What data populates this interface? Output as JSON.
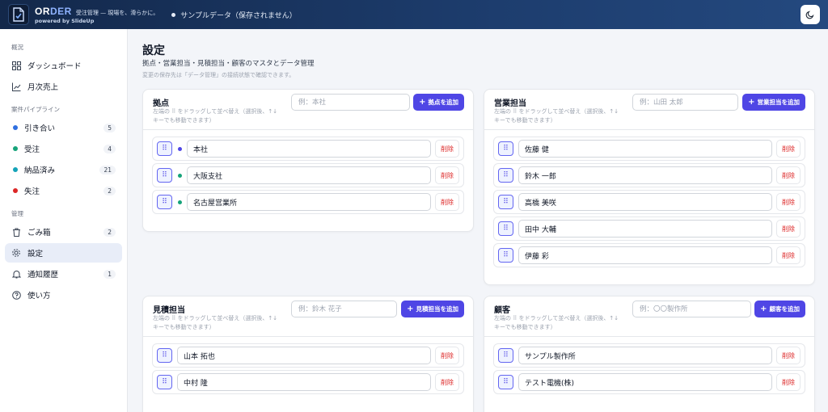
{
  "header": {
    "brand_or": "OR",
    "brand_der": "DER",
    "tagline": "受注管理 — 現場を、滑らかに。",
    "powered": "powered by SlideUp",
    "sample_status": "サンプルデータ（保存されません）",
    "theme_icon": "moon-icon"
  },
  "sidebar": {
    "sections": {
      "overview": "概況",
      "pipeline": "案件パイプライン",
      "manage": "管理"
    },
    "overview": [
      {
        "label": "ダッシュボード",
        "icon": "dashboard-icon"
      },
      {
        "label": "月次売上",
        "icon": "chart-line-icon"
      }
    ],
    "pipeline": [
      {
        "label": "引き合い",
        "count": "5",
        "color": "#2f6fe0"
      },
      {
        "label": "受注",
        "count": "4",
        "color": "#16a37a"
      },
      {
        "label": "納品済み",
        "count": "21",
        "color": "#14a3b8"
      },
      {
        "label": "失注",
        "count": "2",
        "color": "#dc2626"
      }
    ],
    "manage": [
      {
        "label": "ごみ箱",
        "count": "2",
        "icon": "trash-icon"
      },
      {
        "label": "設定",
        "icon": "gear-icon",
        "active": true
      },
      {
        "label": "通知履歴",
        "count": "1",
        "icon": "bell-icon"
      },
      {
        "label": "使い方",
        "icon": "help-icon"
      }
    ]
  },
  "main": {
    "title": "設定",
    "subtitle": "拠点・営業担当・見積担当・顧客のマスタとデータ管理",
    "note": "変更の保存先は「データ管理」の接続状態で確認できます。",
    "hint": "左端の ⠿ をドラッグして並べ替え（選択後、↑↓キーでも移動できます）",
    "delete_label": "削除",
    "cards": {
      "bases": {
        "title": "拠点",
        "placeholder": "例：本社",
        "add_label": "拠点を追加",
        "items": [
          {
            "name": "本社",
            "color": "#4f46e5"
          },
          {
            "name": "大阪支社",
            "color": "#16a37a"
          },
          {
            "name": "名古屋営業所",
            "color": "#16a37a"
          }
        ]
      },
      "sales": {
        "title": "営業担当",
        "placeholder": "例：山田 太郎",
        "add_label": "営業担当を追加",
        "items": [
          {
            "name": "佐藤 健"
          },
          {
            "name": "鈴木 一郎"
          },
          {
            "name": "高橋 美咲"
          },
          {
            "name": "田中 大輔"
          },
          {
            "name": "伊藤 彩"
          }
        ]
      },
      "estimators": {
        "title": "見積担当",
        "placeholder": "例：鈴木 花子",
        "add_label": "見積担当を追加",
        "items": [
          {
            "name": "山本 拓也"
          },
          {
            "name": "中村 隆"
          }
        ]
      },
      "customers": {
        "title": "顧客",
        "placeholder": "例：〇〇製作所",
        "add_label": "顧客を追加",
        "items": [
          {
            "name": "サンプル製作所"
          },
          {
            "name": "テスト電機(株)"
          }
        ]
      }
    }
  }
}
